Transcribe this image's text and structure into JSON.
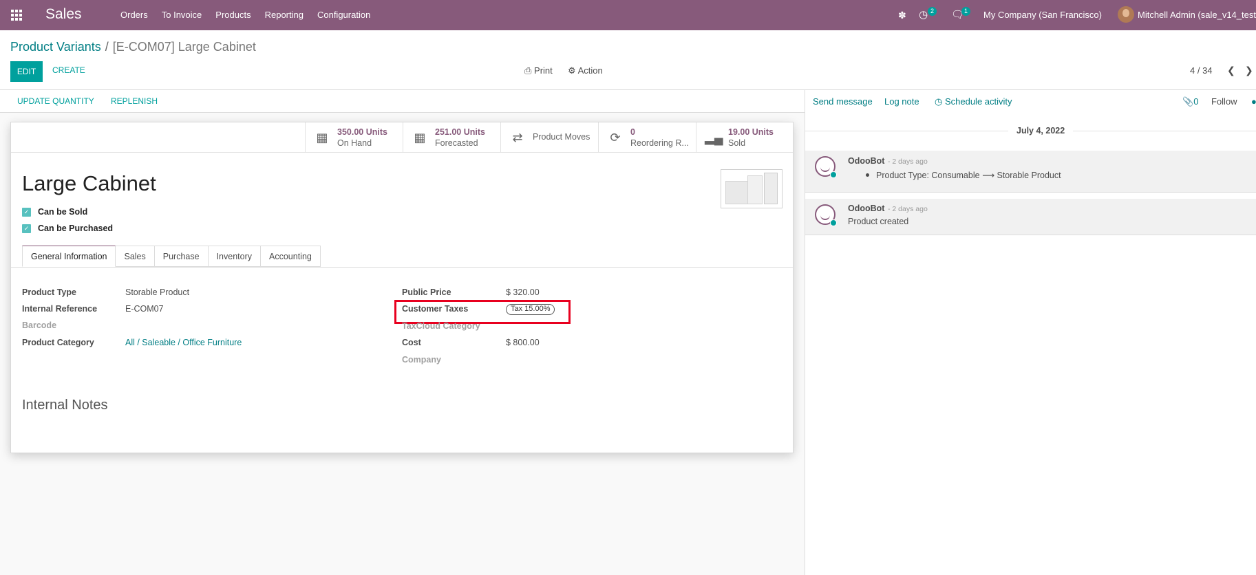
{
  "navbar": {
    "app_name": "Sales",
    "menu": [
      "Orders",
      "To Invoice",
      "Products",
      "Reporting",
      "Configuration"
    ],
    "activity_count": "2",
    "message_count": "1",
    "company": "My Company (San Francisco)",
    "user": "Mitchell Admin (sale_v14_test"
  },
  "control_panel": {
    "breadcrumb_parent": "Product Variants",
    "breadcrumb_sep": "/",
    "breadcrumb_current": "[E-COM07] Large Cabinet",
    "edit_label": "EDIT",
    "create_label": "CREATE",
    "print_label": "Print",
    "action_label": "Action",
    "pager_value": "4 / 34"
  },
  "statusbar": {
    "update_quantity": "UPDATE QUANTITY",
    "replenish": "REPLENISH"
  },
  "smart_buttons": {
    "on_hand_value": "350.00 Units",
    "on_hand_label": "On Hand",
    "forecasted_value": "251.00 Units",
    "forecasted_label": "Forecasted",
    "moves_label": "Product Moves",
    "reordering_value": "0",
    "reordering_label": "Reordering R...",
    "sold_value": "19.00 Units",
    "sold_label": "Sold"
  },
  "product": {
    "name": "Large Cabinet",
    "can_be_sold_label": "Can be Sold",
    "can_be_sold": true,
    "can_be_purchased_label": "Can be Purchased",
    "can_be_purchased": true
  },
  "tabs": [
    "General Information",
    "Sales",
    "Purchase",
    "Inventory",
    "Accounting"
  ],
  "active_tab": "General Information",
  "fields": {
    "product_type_label": "Product Type",
    "product_type": "Storable Product",
    "internal_ref_label": "Internal Reference",
    "internal_ref": "E-COM07",
    "barcode_label": "Barcode",
    "category_label": "Product Category",
    "category": "All / Saleable / Office Furniture",
    "public_price_label": "Public Price",
    "public_price": "$ 320.00",
    "customer_taxes_label": "Customer Taxes",
    "customer_tax_tag": "Tax 15.00%",
    "taxcloud_label": "TaxCloud Category",
    "cost_label": "Cost",
    "cost": "$ 800.00",
    "company_label": "Company"
  },
  "internal_notes_title": "Internal Notes",
  "chatter": {
    "send_message": "Send message",
    "log_note": "Log note",
    "schedule_activity": "Schedule activity",
    "attachments": "0",
    "follow": "Follow",
    "date": "July 4, 2022",
    "messages": [
      {
        "author": "OdooBot",
        "ago": "- 2 days ago",
        "from": "Consumable",
        "to": "Storable Product",
        "field": "Product Type"
      },
      {
        "author": "OdooBot",
        "ago": "- 2 days ago",
        "body": "Product created"
      }
    ]
  },
  "colors": {
    "navbar": "#875a7b",
    "accent": "#00a09d",
    "link": "#017e84",
    "highlight": "#e8001f"
  }
}
